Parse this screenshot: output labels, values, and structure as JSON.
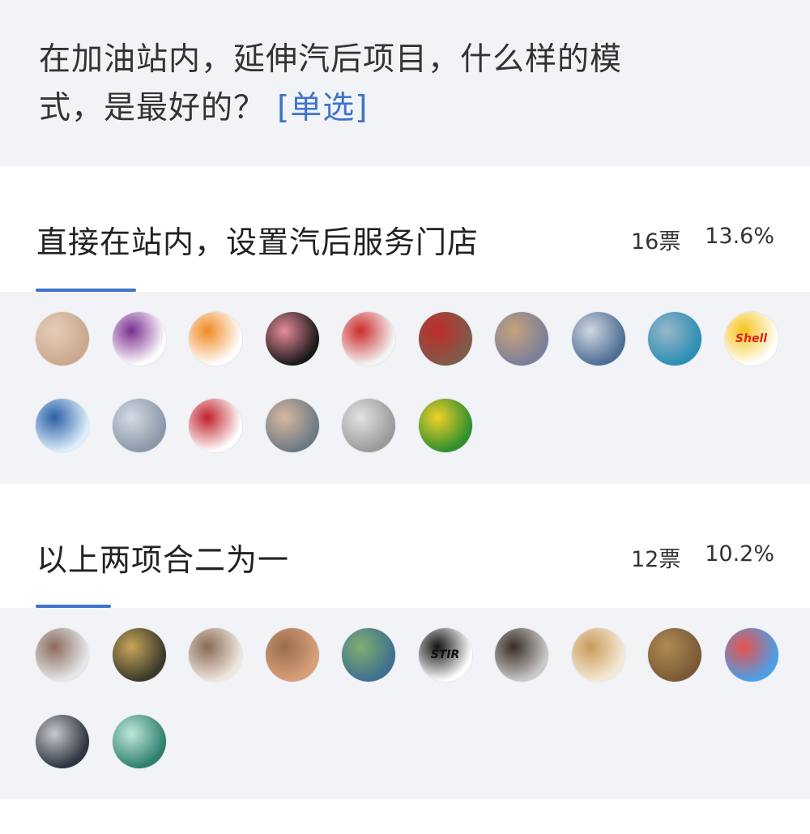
{
  "poll": {
    "question": "在加油站内，延伸汽后项目，什么样的模式，是最好的？",
    "tag": "[单选]"
  },
  "options": [
    {
      "label": "直接在站内，设置汽后服务门店",
      "votes": "16票",
      "percent": "13.6%",
      "share": 0.136,
      "voters": [
        {
          "icon": "feet-photo-avatar",
          "colors": [
            "#c9a88e",
            "#e6cdb8"
          ]
        },
        {
          "icon": "purple-logo-avatar",
          "colors": [
            "#ffffff",
            "#7a2f8f"
          ]
        },
        {
          "icon": "car-heart-avatar",
          "colors": [
            "#ffffff",
            "#f08a24"
          ]
        },
        {
          "icon": "cartoon-pig-avatar",
          "colors": [
            "#1a1a1a",
            "#e88a9a"
          ]
        },
        {
          "icon": "husky-santa-avatar",
          "colors": [
            "#f4f4f4",
            "#cc2a2a"
          ]
        },
        {
          "icon": "storefront-avatar",
          "colors": [
            "#7d5c4a",
            "#c22b2b"
          ]
        },
        {
          "icon": "road-sunset-avatar",
          "colors": [
            "#7b7f99",
            "#c5a27a"
          ]
        },
        {
          "icon": "man-outdoor-avatar",
          "colors": [
            "#4f6d94",
            "#cfd7e2"
          ]
        },
        {
          "icon": "blue-car-avatar",
          "colors": [
            "#2b8fb5",
            "#9ab7c9"
          ]
        },
        {
          "icon": "shell-logo-avatar",
          "colors": [
            "#ffffff",
            "#f6c41b"
          ],
          "text": "Shell"
        },
        {
          "icon": "man-thumbsup-avatar",
          "colors": [
            "#dbeefa",
            "#2a5fa5"
          ]
        },
        {
          "icon": "buildings-avatar",
          "colors": [
            "#8b98a8",
            "#d4dbe3"
          ]
        },
        {
          "icon": "red-logo-avatar",
          "colors": [
            "#ffffff",
            "#c0202a"
          ]
        },
        {
          "icon": "man-portrait-avatar",
          "colors": [
            "#6d7a83",
            "#d8b7a0"
          ]
        },
        {
          "icon": "cartoon-man-avatar",
          "colors": [
            "#9a9a9a",
            "#e3e3e3"
          ]
        },
        {
          "icon": "green-badge-avatar",
          "colors": [
            "#2e8f2e",
            "#f2d12a"
          ]
        }
      ]
    },
    {
      "label": "以上两项合二为一",
      "votes": "12票",
      "percent": "10.2%",
      "share": 0.102,
      "voters": [
        {
          "icon": "older-man-avatar",
          "colors": [
            "#e5e8ea",
            "#8b6b5c"
          ]
        },
        {
          "icon": "climbing-avatar",
          "colors": [
            "#3a3a2a",
            "#c8a45a"
          ]
        },
        {
          "icon": "sketch-couple-avatar",
          "colors": [
            "#efe6dc",
            "#8a6a55"
          ]
        },
        {
          "icon": "desert-person-avatar",
          "colors": [
            "#d8a07a",
            "#9a6d4d"
          ]
        },
        {
          "icon": "lake-man-avatar",
          "colors": [
            "#3f6f8f",
            "#7faf6f"
          ]
        },
        {
          "icon": "stir-logo-avatar",
          "colors": [
            "#ffffff",
            "#111111"
          ],
          "text": "STIR"
        },
        {
          "icon": "man-glasses-avatar",
          "colors": [
            "#c9c9c9",
            "#3a2c26"
          ]
        },
        {
          "icon": "calligraphy-avatar",
          "colors": [
            "#f5ead7",
            "#c99a5a"
          ]
        },
        {
          "icon": "tree-bark-avatar",
          "colors": [
            "#7a5a34",
            "#b08a55"
          ]
        },
        {
          "icon": "koi-fish-avatar",
          "colors": [
            "#4aa0e8",
            "#e8524e"
          ]
        },
        {
          "icon": "family-sunset-avatar",
          "colors": [
            "#2e3440",
            "#c6c9cc"
          ]
        },
        {
          "icon": "arowana-fish-avatar",
          "colors": [
            "#2f7f6e",
            "#bfe9da"
          ]
        }
      ]
    }
  ],
  "colors": {
    "accent": "#3f73c9",
    "background": "#f2f3f7",
    "card": "#ffffff"
  }
}
